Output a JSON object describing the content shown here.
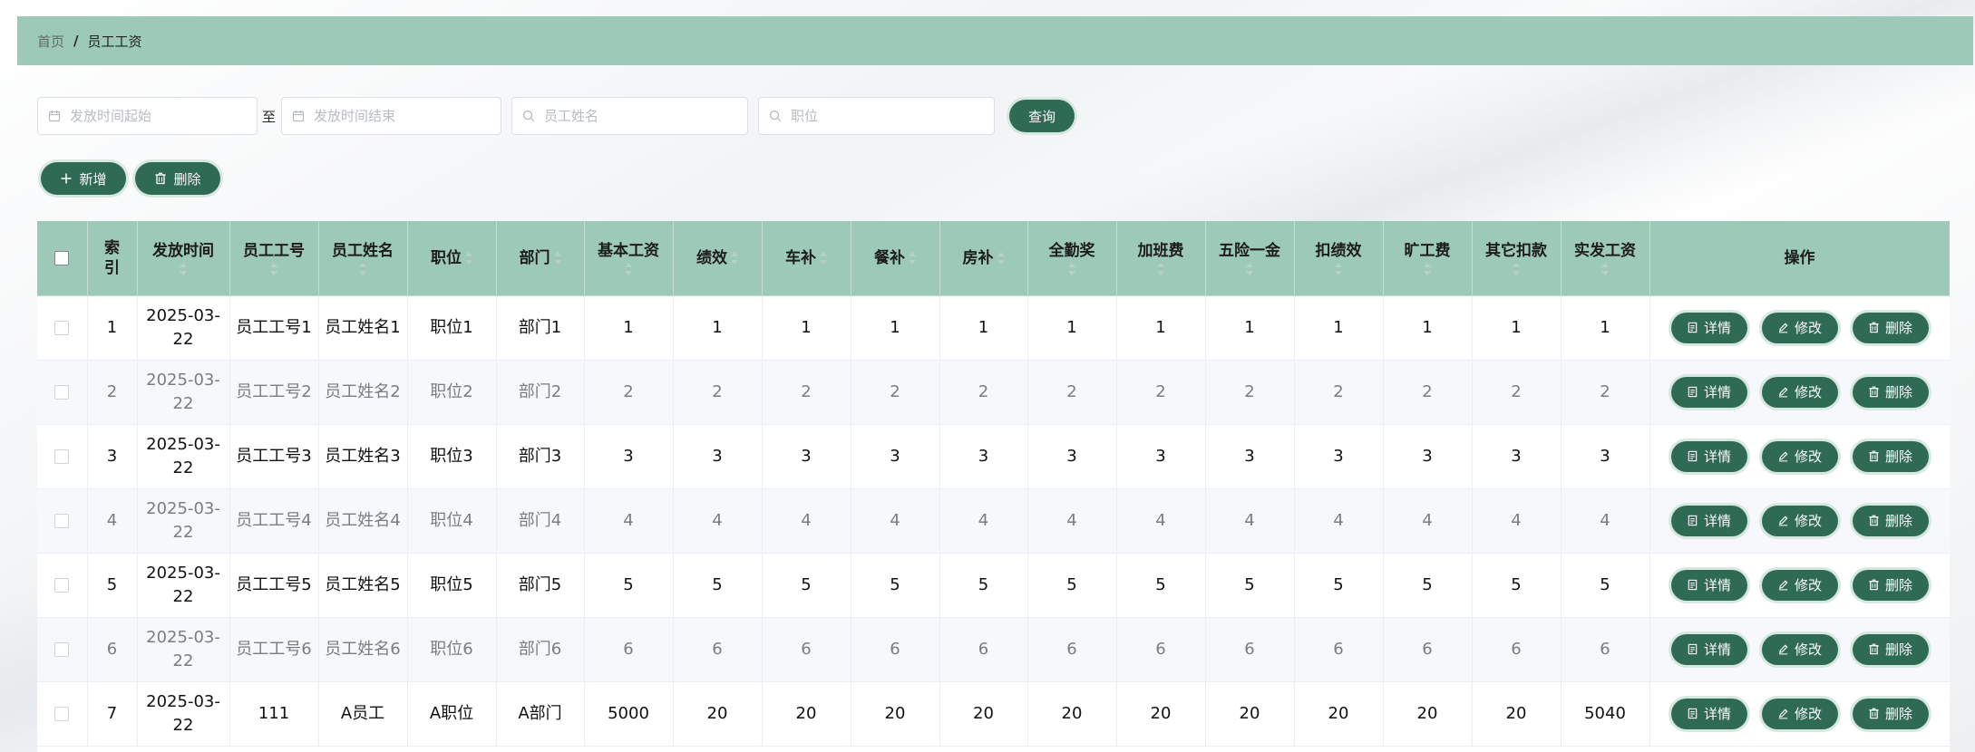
{
  "breadcrumb": {
    "home": "首页",
    "separator": "/",
    "current": "员工工资"
  },
  "search": {
    "start_placeholder": "发放时间起始",
    "to_label": "至",
    "end_placeholder": "发放时间结束",
    "name_placeholder": "员工姓名",
    "position_placeholder": "职位",
    "query_label": "查询"
  },
  "actions": {
    "add_label": "新增",
    "delete_label": "删除"
  },
  "table": {
    "headers": {
      "index": "索引",
      "date": "发放时间",
      "emp_no": "员工工号",
      "emp_name": "员工姓名",
      "position": "职位",
      "dept": "部门",
      "base": "基本工资",
      "perf": "绩效",
      "car": "车补",
      "meal": "餐补",
      "house": "房补",
      "attendance": "全勤奖",
      "overtime": "加班费",
      "insurance": "五险一金",
      "perf_deduct": "扣绩效",
      "absence": "旷工费",
      "other_deduct": "其它扣款",
      "net": "实发工资",
      "ops": "操作"
    },
    "op_labels": {
      "detail": "详情",
      "edit": "修改",
      "delete": "删除"
    },
    "rows": [
      {
        "index": "1",
        "date": "2025-03-22",
        "emp_no": "员工工号1",
        "emp_name": "员工姓名1",
        "position": "职位1",
        "dept": "部门1",
        "base": "1",
        "perf": "1",
        "car": "1",
        "meal": "1",
        "house": "1",
        "attendance": "1",
        "overtime": "1",
        "insurance": "1",
        "perf_deduct": "1",
        "absence": "1",
        "other_deduct": "1",
        "net": "1"
      },
      {
        "index": "2",
        "date": "2025-03-22",
        "emp_no": "员工工号2",
        "emp_name": "员工姓名2",
        "position": "职位2",
        "dept": "部门2",
        "base": "2",
        "perf": "2",
        "car": "2",
        "meal": "2",
        "house": "2",
        "attendance": "2",
        "overtime": "2",
        "insurance": "2",
        "perf_deduct": "2",
        "absence": "2",
        "other_deduct": "2",
        "net": "2"
      },
      {
        "index": "3",
        "date": "2025-03-22",
        "emp_no": "员工工号3",
        "emp_name": "员工姓名3",
        "position": "职位3",
        "dept": "部门3",
        "base": "3",
        "perf": "3",
        "car": "3",
        "meal": "3",
        "house": "3",
        "attendance": "3",
        "overtime": "3",
        "insurance": "3",
        "perf_deduct": "3",
        "absence": "3",
        "other_deduct": "3",
        "net": "3"
      },
      {
        "index": "4",
        "date": "2025-03-22",
        "emp_no": "员工工号4",
        "emp_name": "员工姓名4",
        "position": "职位4",
        "dept": "部门4",
        "base": "4",
        "perf": "4",
        "car": "4",
        "meal": "4",
        "house": "4",
        "attendance": "4",
        "overtime": "4",
        "insurance": "4",
        "perf_deduct": "4",
        "absence": "4",
        "other_deduct": "4",
        "net": "4"
      },
      {
        "index": "5",
        "date": "2025-03-22",
        "emp_no": "员工工号5",
        "emp_name": "员工姓名5",
        "position": "职位5",
        "dept": "部门5",
        "base": "5",
        "perf": "5",
        "car": "5",
        "meal": "5",
        "house": "5",
        "attendance": "5",
        "overtime": "5",
        "insurance": "5",
        "perf_deduct": "5",
        "absence": "5",
        "other_deduct": "5",
        "net": "5"
      },
      {
        "index": "6",
        "date": "2025-03-22",
        "emp_no": "员工工号6",
        "emp_name": "员工姓名6",
        "position": "职位6",
        "dept": "部门6",
        "base": "6",
        "perf": "6",
        "car": "6",
        "meal": "6",
        "house": "6",
        "attendance": "6",
        "overtime": "6",
        "insurance": "6",
        "perf_deduct": "6",
        "absence": "6",
        "other_deduct": "6",
        "net": "6"
      },
      {
        "index": "7",
        "date": "2025-03-22",
        "emp_no": "111",
        "emp_name": "A员工",
        "position": "A职位",
        "dept": "A部门",
        "base": "5000",
        "perf": "20",
        "car": "20",
        "meal": "20",
        "house": "20",
        "attendance": "20",
        "overtime": "20",
        "insurance": "20",
        "perf_deduct": "20",
        "absence": "20",
        "other_deduct": "20",
        "net": "5040"
      }
    ]
  },
  "colors": {
    "header_bg": "#9dc9b8",
    "button_bg": "#2f6a55"
  }
}
